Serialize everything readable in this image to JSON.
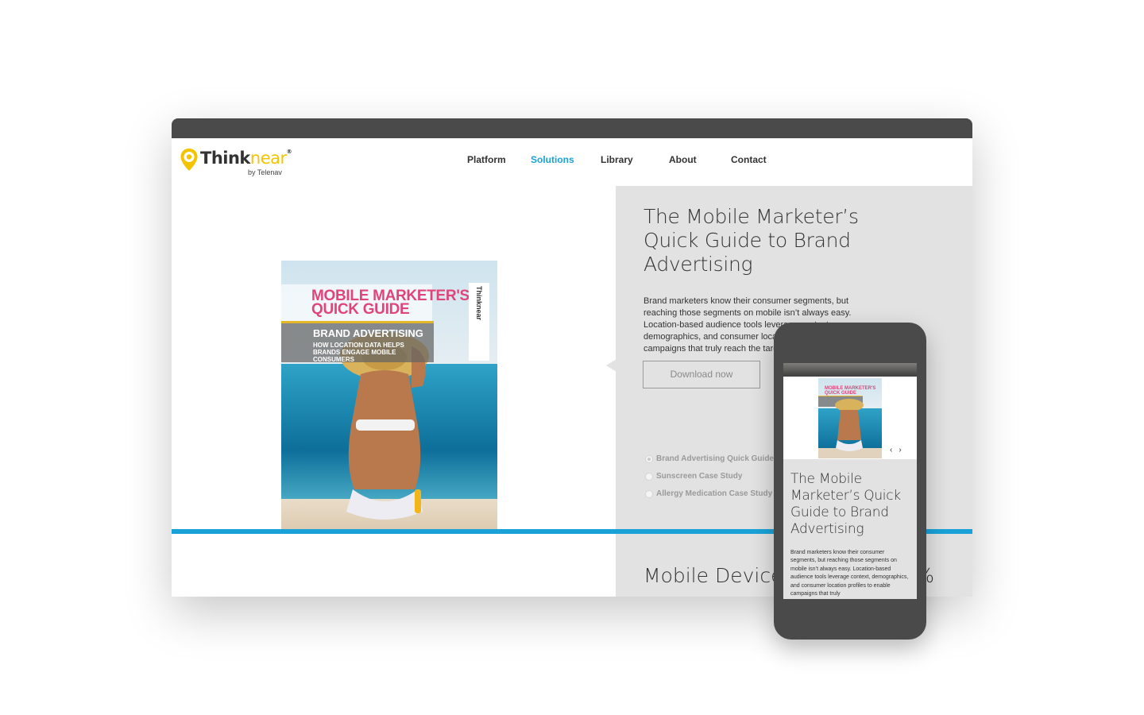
{
  "brand": {
    "logo_word_a": "Think",
    "logo_word_b": "near",
    "logo_reg": "®",
    "logo_sub": "by Telenav",
    "accent_blue": "#1aa2d8",
    "accent_yellow": "#f4c400"
  },
  "nav": {
    "items": [
      {
        "label": "Platform"
      },
      {
        "label": "Solutions"
      },
      {
        "label": "Library"
      },
      {
        "label": "About"
      },
      {
        "label": "Contact"
      }
    ],
    "active": "Solutions"
  },
  "cover": {
    "title_line1": "MOBILE MARKETER'S",
    "title_line2": "QUICK GUIDE",
    "band_title": "BRAND ADVERTISING",
    "band_sub": "HOW LOCATION DATA HELPS BRANDS ENGAGE MOBILE CONSUMERS",
    "tag": "Thinknear"
  },
  "hero": {
    "title": "The Mobile Marketer’s Quick Guide to Brand Advertising",
    "body": "Brand marketers know their consumer segments, but reaching those segments on mobile isn’t always easy. Location-based audience tools leverage context, demographics, and consumer location profiles to enable campaigns that truly reach the target audience.",
    "download_label": "Download now"
  },
  "resources": [
    {
      "label": "Brand Advertising Quick Guide",
      "selected": true
    },
    {
      "label": "Sunscreen Case Study",
      "selected": false
    },
    {
      "label": "Allergy Medication Case Study",
      "selected": false
    }
  ],
  "next_section": {
    "title": "Mobile Device Usage Up 30%"
  },
  "phone": {
    "title": "The Mobile Marketer’s Quick Guide to Brand Advertising",
    "body": "Brand marketers know their consumer segments, but reaching those segments on mobile isn’t always easy. Location-based audience tools leverage context, demographics, and consumer location profiles to enable campaigns that truly",
    "prev": "‹",
    "next": "›"
  }
}
